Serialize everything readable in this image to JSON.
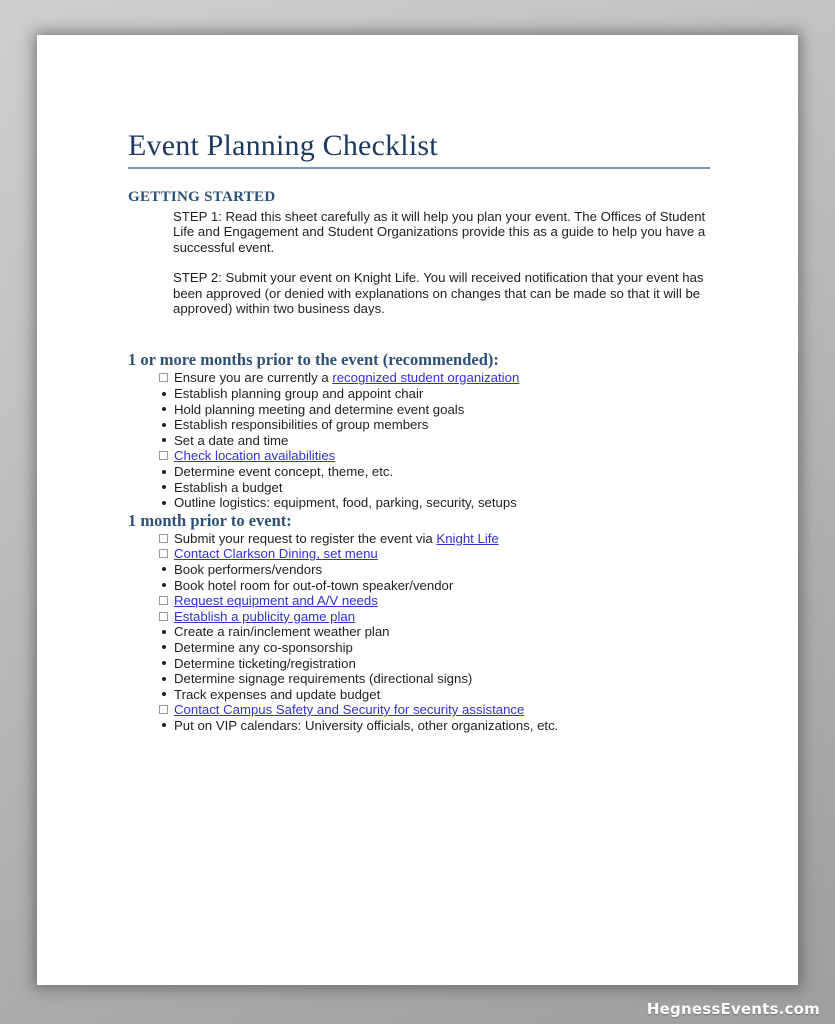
{
  "document": {
    "title": "Event Planning Checklist",
    "getting_started": {
      "heading": "GETTING STARTED",
      "step1": "STEP 1: Read this sheet carefully as it will help you plan your event. The Offices of Student Life and Engagement and Student Organizations provide this as a guide to help you have a successful event.",
      "step2": "STEP 2: Submit your event on Knight Life. You will received notification that your event has been approved (or denied with explanations on changes that can be made so that it will be approved) within two business days."
    },
    "sections": [
      {
        "heading": "1 or more months prior to the event (recommended):",
        "items": [
          {
            "marker": "checkbox",
            "pre": "Ensure you are currently a ",
            "link": "recognized student organization",
            "post": ""
          },
          {
            "marker": "bullet",
            "pre": "Establish planning group and appoint chair",
            "link": "",
            "post": ""
          },
          {
            "marker": "bullet",
            "pre": "Hold planning meeting and determine event goals",
            "link": "",
            "post": ""
          },
          {
            "marker": "bullet",
            "pre": "Establish responsibilities of group members",
            "link": "",
            "post": ""
          },
          {
            "marker": "bullet",
            "pre": "Set a date and time",
            "link": "",
            "post": ""
          },
          {
            "marker": "checkbox",
            "pre": "",
            "link": "Check location availabilities",
            "post": ""
          },
          {
            "marker": "bullet",
            "pre": "Determine event concept, theme, etc.",
            "link": "",
            "post": ""
          },
          {
            "marker": "bullet",
            "pre": "Establish a budget",
            "link": "",
            "post": ""
          },
          {
            "marker": "bullet",
            "pre": "Outline logistics: equipment, food, parking, security, setups",
            "link": "",
            "post": ""
          }
        ]
      },
      {
        "heading": "1 month prior to event:",
        "items": [
          {
            "marker": "checkbox",
            "pre": "Submit your request to register the event via ",
            "link": "Knight Life",
            "post": ""
          },
          {
            "marker": "checkbox",
            "pre": "",
            "link": "Contact Clarkson Dining, set menu",
            "post": ""
          },
          {
            "marker": "bullet",
            "pre": "Book performers/vendors",
            "link": "",
            "post": ""
          },
          {
            "marker": "bullet",
            "pre": "Book hotel room for out-of-town speaker/vendor",
            "link": "",
            "post": ""
          },
          {
            "marker": "checkbox",
            "pre": "",
            "link": "Request equipment and A/V needs",
            "post": ""
          },
          {
            "marker": "checkbox",
            "pre": "",
            "link": "Establish a publicity game plan",
            "post": ""
          },
          {
            "marker": "bullet",
            "pre": "Create a rain/inclement weather plan",
            "link": "",
            "post": ""
          },
          {
            "marker": "bullet",
            "pre": "Determine any co-sponsorship",
            "link": "",
            "post": ""
          },
          {
            "marker": "bullet",
            "pre": "Determine ticketing/registration",
            "link": "",
            "post": ""
          },
          {
            "marker": "bullet",
            "pre": "Determine signage requirements (directional signs)",
            "link": "",
            "post": ""
          },
          {
            "marker": "bullet",
            "pre": "Track expenses and update budget",
            "link": "",
            "post": ""
          },
          {
            "marker": "checkbox",
            "pre": "",
            "link": "Contact Campus Safety and Security for security assistance",
            "post": ""
          },
          {
            "marker": "bullet",
            "pre": "Put on VIP calendars: University officials, other organizations, etc.",
            "link": "",
            "post": ""
          }
        ]
      }
    ]
  },
  "watermark": {
    "text": "HegnessEvents.com"
  },
  "colors": {
    "title": "#1F3A60",
    "heading": "#2E5077",
    "link": "#3333CC",
    "rule": "#8093B3",
    "body_text": "#231F20"
  }
}
